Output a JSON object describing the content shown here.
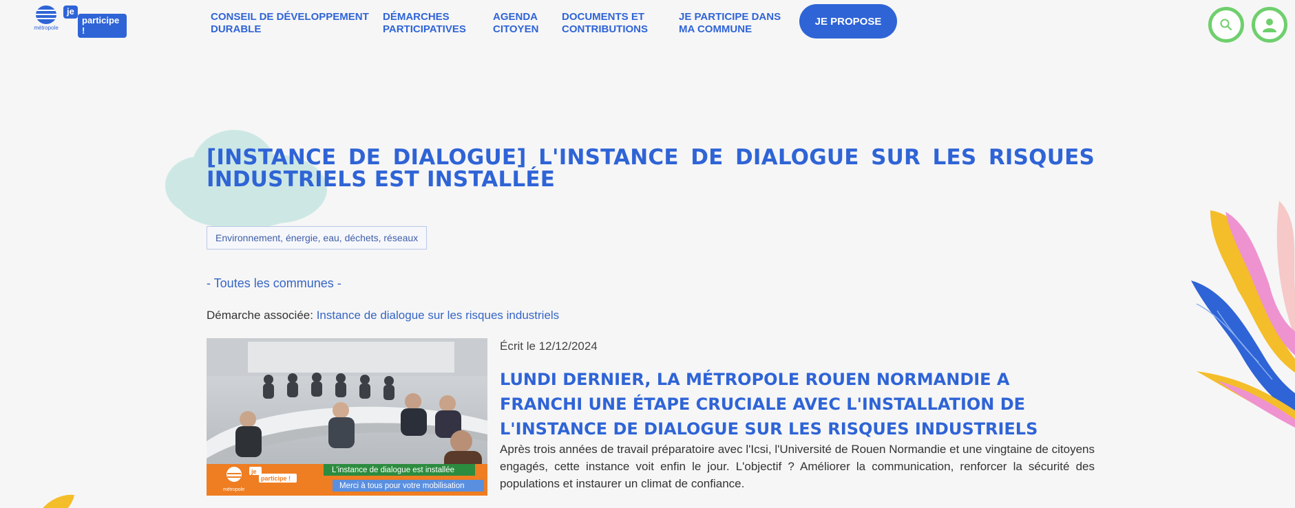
{
  "header": {
    "logo_metropole": "métropole",
    "logo_je": "je",
    "logo_participe": "participe !",
    "nav": [
      {
        "line1": "Conseil de développement",
        "line2": "durable"
      },
      {
        "line1": "Démarches",
        "line2": "participatives"
      },
      {
        "line1": "Agenda",
        "line2": "citoyen"
      },
      {
        "line1": "Documents et",
        "line2": "contributions"
      },
      {
        "line1": "Je participe dans",
        "line2": "ma commune"
      }
    ],
    "propose_label": "JE PROPOSE",
    "search_icon": "search-icon",
    "user_icon": "user-icon"
  },
  "colors": {
    "brand_blue": "#2f64d6",
    "green": "#6fcf6d",
    "cloud": "#cde8e4",
    "orange": "#ef7d22"
  },
  "page": {
    "title": "[Instance de dialogue] L'instance de dialogue sur les risques industriels est installée",
    "tag": "Environnement, énergie, eau, déchets, réseaux",
    "communes": "- Toutes les communes -",
    "demarche_label": "Démarche associée:",
    "demarche_link": "Instance de dialogue sur les risques industriels"
  },
  "article": {
    "date": "Écrit le 12/12/2024",
    "title": "Lundi dernier, la Métropole Rouen Normandie a franchi une étape cruciale avec l'installation de l'instance de dialogue sur les risques industriels",
    "text": "Après trois années de travail préparatoire avec l'Icsi, l'Université de Rouen Normandie et une vingtaine de citoyens engagés, cette instance voit enfin le jour. L'objectif ? Améliorer la communication, renforcer la sécurité des populations et instaurer un climat de confiance.",
    "image_banner_1": "L'instance de dialogue est installée",
    "image_banner_2": "Merci à tous pour votre mobilisation",
    "image_logo_je": "je",
    "image_logo_participe": "participe !",
    "image_logo_metropole": "métropole"
  }
}
